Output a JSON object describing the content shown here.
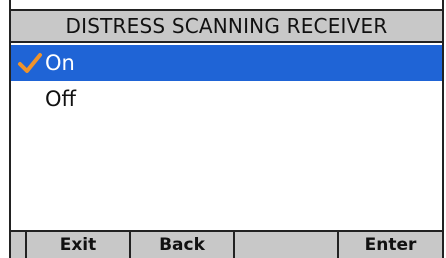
{
  "title": "DISTRESS SCANNING RECEIVER",
  "options": [
    {
      "label": "On",
      "selected": true,
      "checked": true
    },
    {
      "label": "Off",
      "selected": false,
      "checked": false
    }
  ],
  "softkeys": [
    "",
    "Exit",
    "Back",
    "",
    "Enter"
  ],
  "colors": {
    "selection": "#1f64d6",
    "checkmark": "#f0932b",
    "bar": "#c8c8c8"
  },
  "icons": {
    "checked": "checkmark-icon"
  }
}
